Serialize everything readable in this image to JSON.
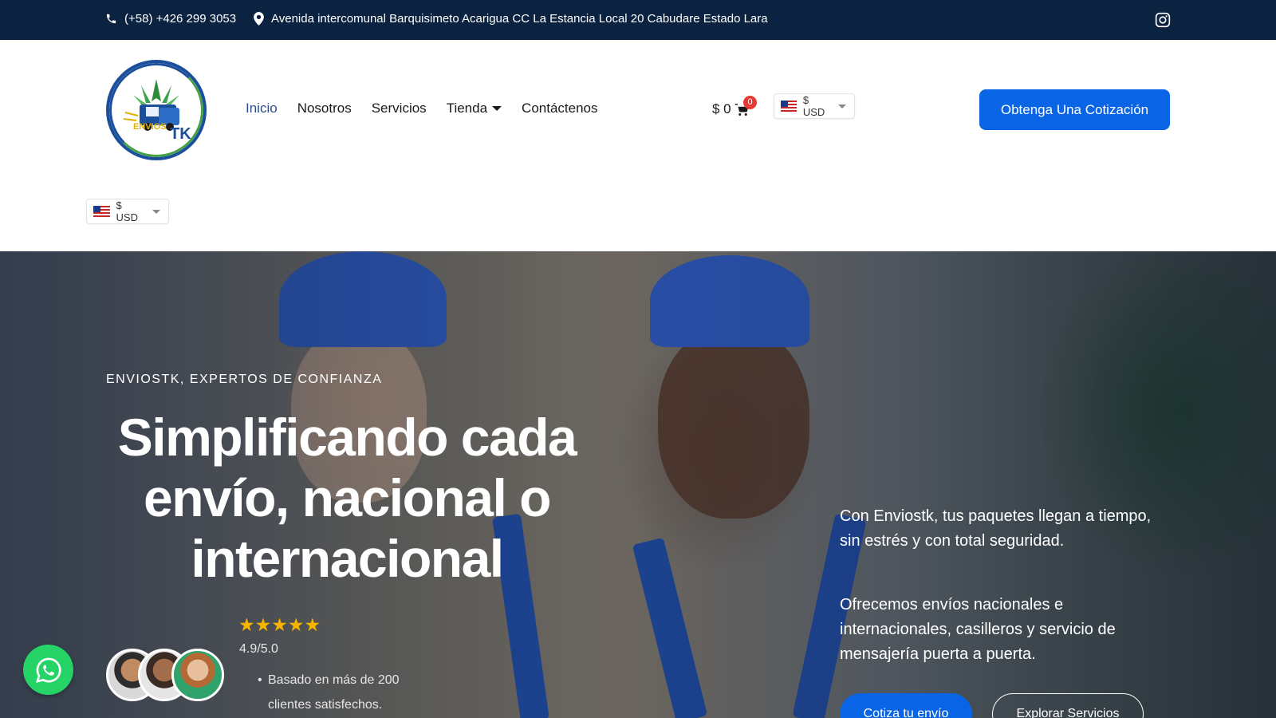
{
  "topbar": {
    "phone": "(+58) +426 299 3053",
    "address": "Avenida intercomunal Barquisimeto Acarigua CC La Estancia Local 20 Cabudare Estado Lara"
  },
  "logo": {
    "line1": "ENVIOS",
    "line2": "TK"
  },
  "nav": {
    "inicio": "Inicio",
    "nosotros": "Nosotros",
    "servicios": "Servicios",
    "tienda": "Tienda",
    "contactenos": "Contáctenos"
  },
  "cart": {
    "amount": "$ 0",
    "count": "0"
  },
  "currency": {
    "label": "$ USD"
  },
  "header": {
    "quote_button": "Obtenga Una Cotización"
  },
  "hero": {
    "eyebrow": "ENVIOSTK, EXPERTOS DE CONFIANZA",
    "headline": "Simplificando cada envío, nacional o internacional",
    "stars": "★★★★★",
    "rating": 4.9,
    "rating_text": "4.9/5.0",
    "based_on": "Basado en más de 200 clientes satisfechos.",
    "paragraph1": "Con Enviostk, tus paquetes llegan a tiempo, sin estrés y con total seguridad.",
    "paragraph2": "Ofrecemos envíos nacionales e internacionales, casilleros y servicio de mensajería puerta a puerta.",
    "primary_button": "Cotiza tu envío",
    "secondary_button": "Explorar Servicios"
  },
  "colors": {
    "topbar_bg": "#0b2240",
    "primary": "#0a64e6",
    "whatsapp": "#25d366",
    "star": "#f6b400"
  },
  "icons": [
    "phone-icon",
    "map-pin-icon",
    "instagram-icon",
    "cart-icon",
    "us-flag-icon",
    "whatsapp-icon"
  ]
}
